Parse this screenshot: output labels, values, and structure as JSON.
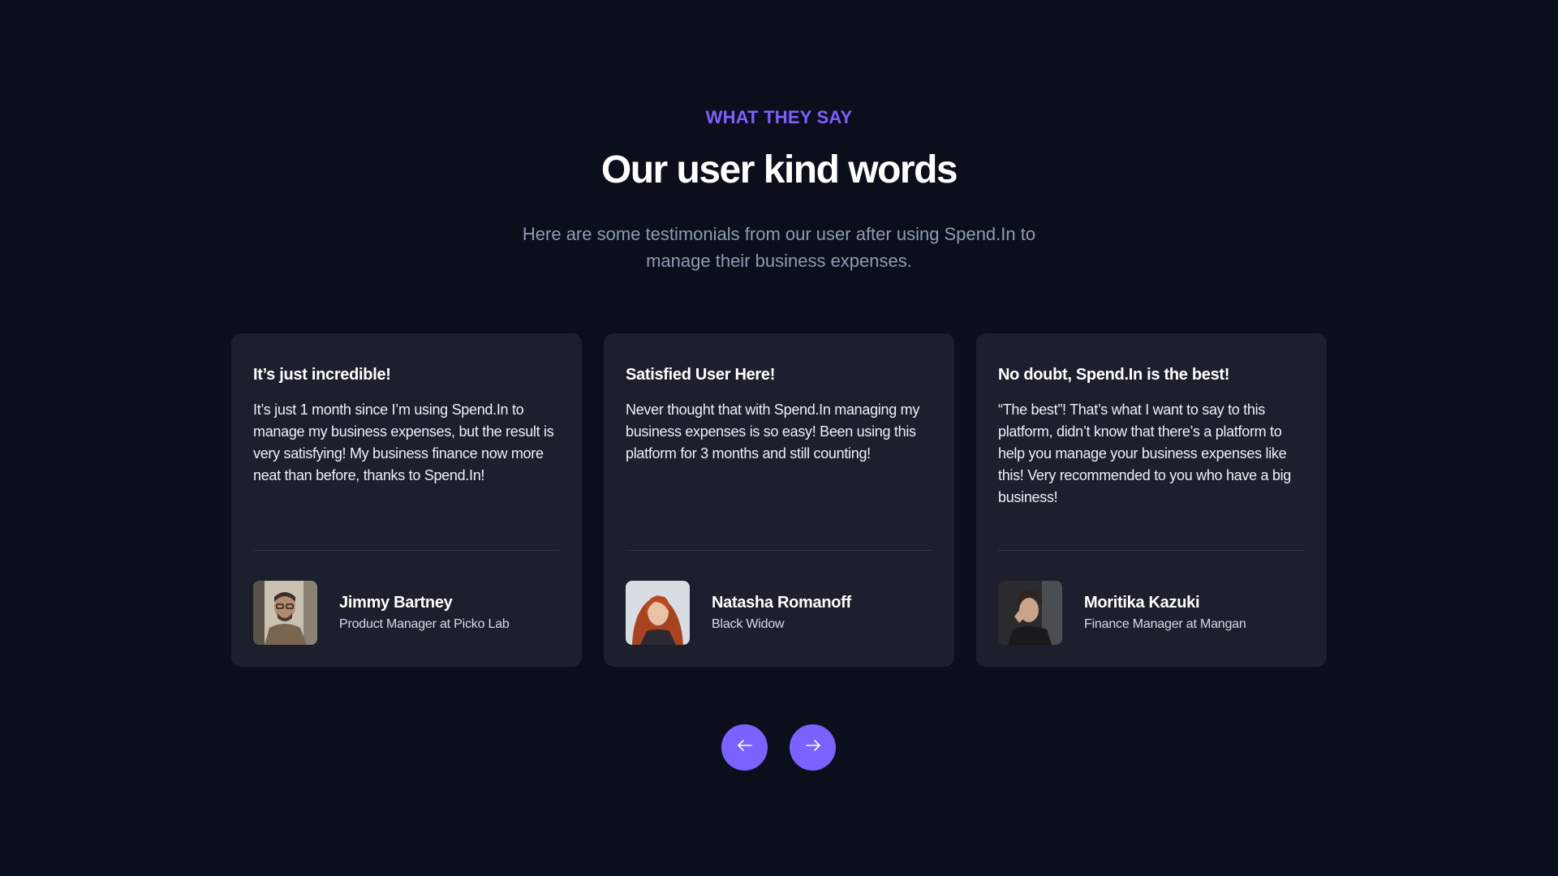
{
  "header": {
    "eyebrow": "WHAT THEY SAY",
    "title": "Our user kind words",
    "subtitle": "Here are some testimonials from our user after using Spend.In to manage their business expenses."
  },
  "testimonials": [
    {
      "title": "It’s just incredible!",
      "body": "It’s just 1 month since I’m using Spend.In to manage my business expenses, but the result is very satisfying! My business finance now more neat than before, thanks to Spend.In!",
      "name": "Jimmy Bartney",
      "role": "Product Manager at Picko Lab"
    },
    {
      "title": "Satisfied User Here!",
      "body": "Never thought that with Spend.In managing my business expenses is so easy! Been using this platform for 3 months and still counting!",
      "name": "Natasha Romanoff",
      "role": "Black Widow"
    },
    {
      "title": "No doubt, Spend.In is the best!",
      "body": "“The best”! That’s what I want to say to this platform, didn’t know that there’s a platform to help you manage your business expenses like this! Very recommended to you who have a big business!",
      "name": "Moritika Kazuki",
      "role": "Finance Manager at Mangan"
    }
  ],
  "navigation": {
    "prev_icon": "arrow-left-icon",
    "next_icon": "arrow-right-icon"
  },
  "colors": {
    "background": "#0b0f1b",
    "card": "#1b202c",
    "accent": "#7b61ff",
    "subtitle": "#8e9bb4"
  }
}
